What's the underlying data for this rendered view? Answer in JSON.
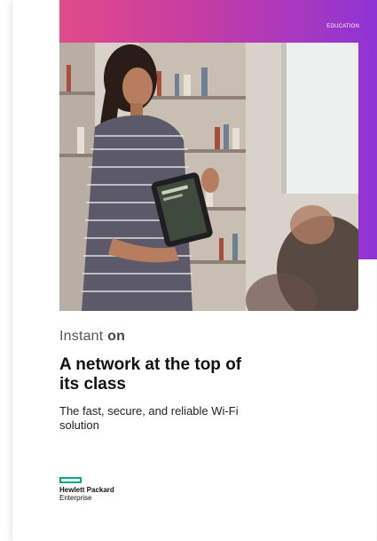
{
  "cover": {
    "section_tag": "EDUCATION",
    "brand_text": "Instant",
    "brand_mark": "on",
    "headline": "A network at the top of its class",
    "subhead": "The fast, secure, and reliable Wi-Fi solution",
    "logo_line1": "Hewlett Packard",
    "logo_line2": "Enterprise"
  },
  "colors": {
    "gradient_start": "#e0448e",
    "gradient_end": "#8f35d6",
    "hpe_green": "#01a982"
  }
}
